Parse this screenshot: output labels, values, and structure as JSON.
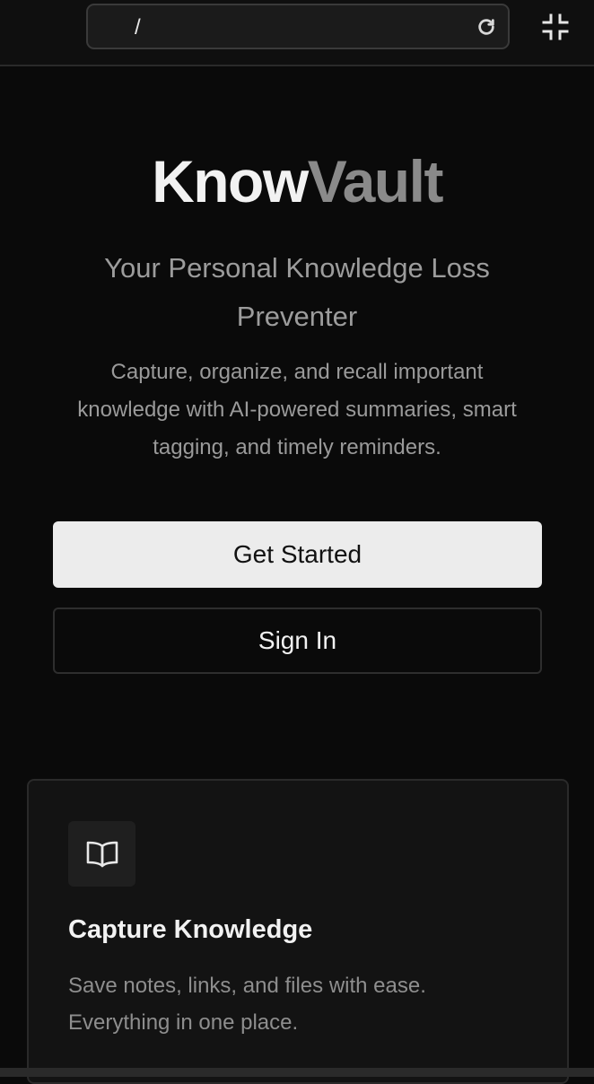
{
  "browser": {
    "url": "/",
    "reload_icon": "reload-icon",
    "exit_fullscreen_icon": "exit-fullscreen-icon"
  },
  "hero": {
    "brand_part1": "Know",
    "brand_part2": "Vault",
    "tagline": "Your Personal Knowledge Loss Preventer",
    "description": "Capture, organize, and recall important knowledge with AI-powered summaries, smart tagging, and timely reminders.",
    "primary_button": "Get Started",
    "secondary_button": "Sign In"
  },
  "features": [
    {
      "icon": "book-open-icon",
      "title": "Capture Knowledge",
      "description": "Save notes, links, and files with ease. Everything in one place."
    }
  ],
  "colors": {
    "background": "#0a0a0a",
    "brand_primary": "#f2f2f2",
    "brand_secondary": "#8a8a8a",
    "primary_button_bg": "#ececec"
  }
}
